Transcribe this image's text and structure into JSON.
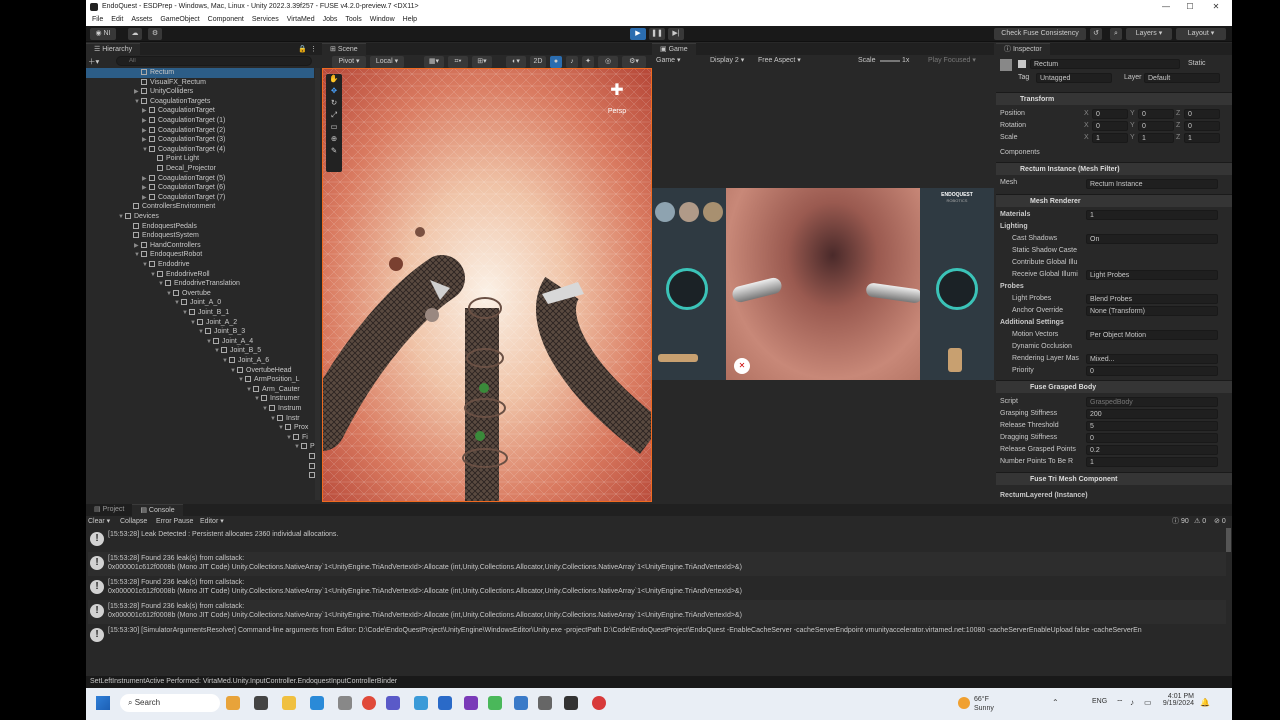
{
  "window": {
    "title": "EndoQuest - ESDPrep - Windows, Mac, Linux - Unity 2022.3.39f257 - FUSE v4.2.0-preview.7 <DX11>"
  },
  "menu": [
    "File",
    "Edit",
    "Assets",
    "GameObject",
    "Component",
    "Services",
    "VirtaMed",
    "Jobs",
    "Tools",
    "Window",
    "Help"
  ],
  "toolbar": {
    "account": "NI",
    "check_fuse": "Check Fuse Consistency",
    "layers": "Layers",
    "layout": "Layout"
  },
  "hierarchy": {
    "title": "Hierarchy",
    "search_placeholder": "All",
    "items": [
      {
        "label": "Rectum",
        "depth": 5,
        "arrow": "",
        "selected": true
      },
      {
        "label": "VisualFX_Rectum",
        "depth": 5,
        "arrow": ""
      },
      {
        "label": "UnityColliders",
        "depth": 5,
        "arrow": "▶"
      },
      {
        "label": "CoagulationTargets",
        "depth": 5,
        "arrow": "▼"
      },
      {
        "label": "CoagulationTarget",
        "depth": 6,
        "arrow": "▶"
      },
      {
        "label": "CoagulationTarget (1)",
        "depth": 6,
        "arrow": "▶"
      },
      {
        "label": "CoagulationTarget (2)",
        "depth": 6,
        "arrow": "▶"
      },
      {
        "label": "CoagulationTarget (3)",
        "depth": 6,
        "arrow": "▶"
      },
      {
        "label": "CoagulationTarget (4)",
        "depth": 6,
        "arrow": "▼"
      },
      {
        "label": "Point Light",
        "depth": 7,
        "arrow": ""
      },
      {
        "label": "Decal_Projector",
        "depth": 7,
        "arrow": ""
      },
      {
        "label": "CoagulationTarget (5)",
        "depth": 6,
        "arrow": "▶"
      },
      {
        "label": "CoagulationTarget (6)",
        "depth": 6,
        "arrow": "▶"
      },
      {
        "label": "CoagulationTarget (7)",
        "depth": 6,
        "arrow": "▶"
      },
      {
        "label": "ControllersEnvironment",
        "depth": 4,
        "arrow": ""
      },
      {
        "label": "Devices",
        "depth": 3,
        "arrow": "▼"
      },
      {
        "label": "EndoquestPedals",
        "depth": 4,
        "arrow": ""
      },
      {
        "label": "EndoquestSystem",
        "depth": 4,
        "arrow": ""
      },
      {
        "label": "HandControllers",
        "depth": 5,
        "arrow": "▶"
      },
      {
        "label": "EndoquestRobot",
        "depth": 5,
        "arrow": "▼"
      },
      {
        "label": "Endodrive",
        "depth": 6,
        "arrow": "▼"
      },
      {
        "label": "EndodriveRoll",
        "depth": 7,
        "arrow": "▼"
      },
      {
        "label": "EndodriveTranslation",
        "depth": 8,
        "arrow": "▼"
      },
      {
        "label": "Overtube",
        "depth": 9,
        "arrow": "▼"
      },
      {
        "label": "Joint_A_0",
        "depth": 10,
        "arrow": "▼"
      },
      {
        "label": "Joint_B_1",
        "depth": 11,
        "arrow": "▼"
      },
      {
        "label": "Joint_A_2",
        "depth": 12,
        "arrow": "▼"
      },
      {
        "label": "Joint_B_3",
        "depth": 13,
        "arrow": "▼"
      },
      {
        "label": "Joint_A_4",
        "depth": 14,
        "arrow": "▼"
      },
      {
        "label": "Joint_B_5",
        "depth": 15,
        "arrow": "▼"
      },
      {
        "label": "Joint_A_6",
        "depth": 16,
        "arrow": "▼"
      },
      {
        "label": "OvertubeHead",
        "depth": 17,
        "arrow": "▼"
      },
      {
        "label": "ArmPosition_L",
        "depth": 18,
        "arrow": "▼"
      },
      {
        "label": "Arm_Cauter",
        "depth": 19,
        "arrow": "▼"
      },
      {
        "label": "Instrumer",
        "depth": 20,
        "arrow": "▼"
      },
      {
        "label": "Instrum",
        "depth": 21,
        "arrow": "▼"
      },
      {
        "label": "Instr",
        "depth": 22,
        "arrow": "▼"
      },
      {
        "label": "Prox",
        "depth": 23,
        "arrow": "▼"
      },
      {
        "label": "Fi",
        "depth": 24,
        "arrow": "▼"
      },
      {
        "label": "P",
        "depth": 25,
        "arrow": "▼"
      },
      {
        "label": "",
        "depth": 26,
        "arrow": ""
      },
      {
        "label": "",
        "depth": 26,
        "arrow": ""
      },
      {
        "label": "",
        "depth": 26,
        "arrow": ""
      }
    ]
  },
  "scene": {
    "tab": "Scene",
    "pivot": "Pivot",
    "local": "Local",
    "mode_2d": "2D",
    "persp": "Persp"
  },
  "game": {
    "tab": "Game",
    "mode": "Game",
    "display": "Display 2",
    "aspect": "Free Aspect",
    "scale_label": "Scale",
    "scale_value": "1x",
    "play_focused": "Play Focused",
    "logo": "ENDOQUEST",
    "sub": "ROBOTICS"
  },
  "inspector": {
    "title": "Inspector",
    "object_name": "Rectum",
    "static": "Static",
    "tag_label": "Tag",
    "tag_value": "Untagged",
    "layer_label": "Layer",
    "layer_value": "Default",
    "transform": {
      "title": "Transform",
      "position": {
        "label": "Position",
        "x": "0",
        "y": "0",
        "z": "0"
      },
      "rotation": {
        "label": "Rotation",
        "x": "0",
        "y": "0",
        "z": "0"
      },
      "scale": {
        "label": "Scale",
        "x": "1",
        "y": "1",
        "z": "1"
      }
    },
    "components_label": "Components",
    "mesh_filter": {
      "title": "Rectum Instance (Mesh Filter)",
      "mesh_label": "Mesh",
      "mesh_value": "Rectum Instance"
    },
    "mesh_renderer": {
      "title": "Mesh Renderer",
      "materials_label": "Materials",
      "materials_value": "1",
      "lighting": "Lighting",
      "cast_shadows_label": "Cast Shadows",
      "cast_shadows_value": "On",
      "static_shadow_label": "Static Shadow Caste",
      "contribute_gi_label": "Contribute Global Illu",
      "receive_gi_label": "Receive Global Illumi",
      "receive_gi_value": "Light Probes",
      "probes": "Probes",
      "light_probes_label": "Light Probes",
      "light_probes_value": "Blend Probes",
      "anchor_label": "Anchor Override",
      "anchor_value": "None (Transform)",
      "additional": "Additional Settings",
      "motion_label": "Motion Vectors",
      "motion_value": "Per Object Motion",
      "dyn_occ_label": "Dynamic Occlusion",
      "render_layer_label": "Rendering Layer Mas",
      "render_layer_value": "Mixed...",
      "priority_label": "Priority",
      "priority_value": "0"
    },
    "fuse_grasped": {
      "title": "Fuse Grasped Body",
      "script_label": "Script",
      "script_value": "GraspedBody",
      "grasp_label": "Grasping Stiffness",
      "grasp_value": "200",
      "release_label": "Release Threshold",
      "release_value": "5",
      "drag_label": "Dragging Stiffness",
      "drag_value": "0",
      "rel_pts_label": "Release Grasped Points",
      "rel_pts_value": "0.2",
      "num_pts_label": "Number Points To Be R",
      "num_pts_value": "1"
    },
    "fuse_tri": {
      "title": "Fuse Tri Mesh Component"
    },
    "footer": "RectumLayered (Instance)"
  },
  "console": {
    "tab_project": "Project",
    "tab_console": "Console",
    "clear": "Clear",
    "collapse": "Collapse",
    "error_pause": "Error Pause",
    "editor": "Editor",
    "count_log": "90",
    "count_warn": "0",
    "count_err": "0",
    "logs": [
      {
        "l1": "[15:53:28] Leak Detected : Persistent allocates 2360 individual allocations.",
        "l2": ""
      },
      {
        "l1": "[15:53:28] Found 236 leak(s) from callstack:",
        "l2": "0x000001c612f0008b (Mono JIT Code) Unity.Collections.NativeArray`1<UnityEngine.TriAndVertexId>:Allocate (int,Unity.Collections.Allocator,Unity.Collections.NativeArray`1<UnityEngine.TriAndVertexId>&)"
      },
      {
        "l1": "[15:53:28] Found 236 leak(s) from callstack:",
        "l2": "0x000001c612f0008b (Mono JIT Code) Unity.Collections.NativeArray`1<UnityEngine.TriAndVertexId>:Allocate (int,Unity.Collections.Allocator,Unity.Collections.NativeArray`1<UnityEngine.TriAndVertexId>&)"
      },
      {
        "l1": "[15:53:28] Found 236 leak(s) from callstack:",
        "l2": "0x000001c612f0008b (Mono JIT Code) Unity.Collections.NativeArray`1<UnityEngine.TriAndVertexId>:Allocate (int,Unity.Collections.Allocator,Unity.Collections.NativeArray`1<UnityEngine.TriAndVertexId>&)"
      },
      {
        "l1": "[15:53:30] [SimulatorArgumentsResolver] Command-line arguments from Editor: D:\\Code\\EndoQuestProject\\UnityEngine\\WindowsEditor\\Unity.exe -projectPath D:\\Code\\EndoQuestProject\\EndoQuest -EnableCacheServer -cacheServerEndpoint vmunityaccelerator.virtamed.net:10080 -cacheServerEnableUpload false -cacheServerEn",
        "l2": ""
      }
    ]
  },
  "status": "SetLeftInstrumentActive Performed: VirtaMed.Unity.InputController.EndoquestInputControllerBinder",
  "taskbar": {
    "search": "Search",
    "weather_temp": "66°F",
    "weather_desc": "Sunny",
    "lang": "ENG",
    "time": "4:01 PM",
    "date": "9/19/2024"
  }
}
